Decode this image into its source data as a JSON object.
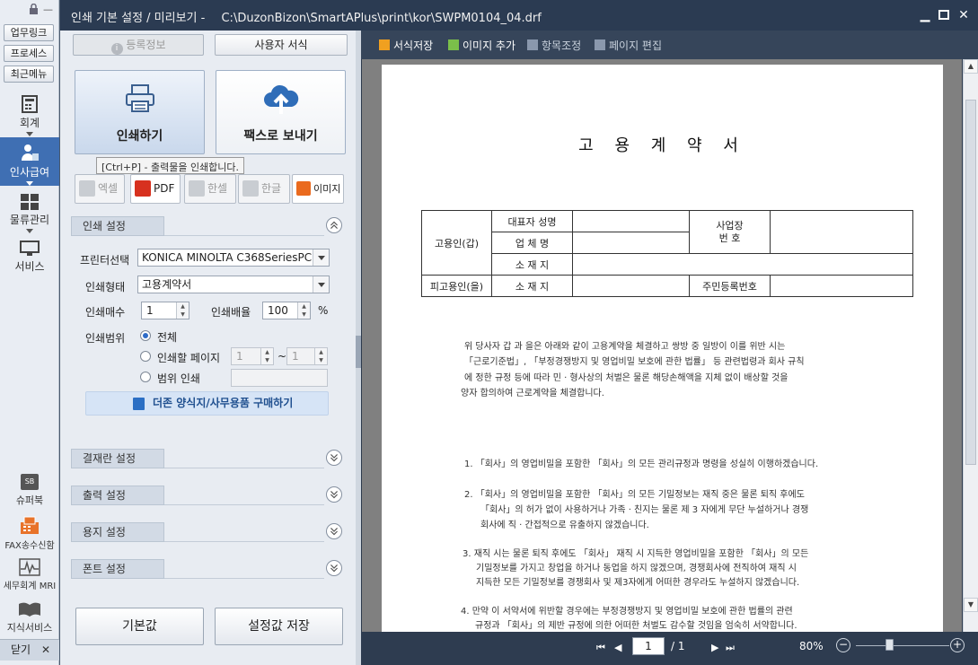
{
  "sidebar": {
    "quick_links": [
      "업무링크",
      "프로세스",
      "최근메뉴"
    ],
    "nav": [
      {
        "label": "회계",
        "icon": "calculator-icon"
      },
      {
        "label": "인사급여",
        "icon": "person-icon"
      },
      {
        "label": "물류관리",
        "icon": "grid-icon"
      },
      {
        "label": "서비스",
        "icon": "monitor-icon"
      }
    ],
    "bottom": [
      {
        "label": "슈퍼북",
        "badge": "SB"
      },
      {
        "label": "FAX송수신함"
      },
      {
        "label": "세무회계 MRI"
      },
      {
        "label": "지식서비스"
      }
    ],
    "close_label": "닫기"
  },
  "window": {
    "title": "인쇄 기본 설정 / 미리보기 -",
    "path": "C:\\DuzonBizon\\SmartAPlus\\print\\kor\\SWPM0104_04.drf"
  },
  "settings": {
    "register_label": "등록정보",
    "user_form_label": "사용자 서식",
    "print_label": "인쇄하기",
    "fax_label": "팩스로 보내기",
    "tooltip": "[Ctrl+P] - 출력물을 인쇄합니다.",
    "exports": [
      "엑셀",
      "PDF",
      "한셀",
      "한글",
      "이미지"
    ],
    "print_section": "인쇄 설정",
    "printer_label": "프린터선택",
    "printer_value": "KONICA MINOLTA C368SeriesPCL",
    "format_label": "인쇄형태",
    "format_value": "고용계약서",
    "copies_label": "인쇄매수",
    "copies_value": "1",
    "scale_label": "인쇄배율",
    "scale_value": "100",
    "scale_unit": "%",
    "range_label": "인쇄범위",
    "range_all": "전체",
    "range_pages": "인쇄할 페이지",
    "page_from": "1",
    "page_to": "1",
    "range_sep": "~",
    "range_scope": "범위 인쇄",
    "buy_banner": "더존 양식지/사무용품 구매하기",
    "collapsed_sections": [
      "결재란 설정",
      "출력 설정",
      "용지 설정",
      "폰트 설정"
    ],
    "default_label": "기본값",
    "save_label": "설정값 저장"
  },
  "preview": {
    "toolbar": [
      "서식저장",
      "이미지 추가",
      "항목조정",
      "페이지 편집"
    ],
    "doc_title": "고 용 계 약 서",
    "table": {
      "employer": "고용인(갑)",
      "rep": "대표자 성명",
      "company": "업 체 명",
      "addr": "소 재 지",
      "biz_no": "사업장\n번 호",
      "employee": "피고용인(을)",
      "addr2": "소 재 지",
      "rrn": "주민등록번호"
    },
    "intro": [
      "위 당사자 갑 과 을은 아래와 같이 고용계약을 체결하고 쌍방 중 일방이 이를 위반 시는",
      "「근로기준법」, 「부정경쟁방지 및 영업비밀 보호에 관한 법률」 등 관련법령과 회사 규칙",
      "에 정한 규정 등에 따라 민 · 형사상의 처벌은 물론 해당손해액을 지체 없이 배상할 것을",
      "양자 합의하여 근로계약을 체결합니다."
    ],
    "clauses": [
      [
        "1. 「회사」의 영업비밀을 포함한 「회사」의 모든 관리규정과 명령을 성실히 이행하겠습니다."
      ],
      [
        "2. 「회사」의 영업비밀을 포함한 「회사」의 모든 기밀정보는 재직 중은 물론 퇴직 후에도",
        "「회사」의 허가 없이 사용하거나 가족 · 친지는 물론 제 3 자에게 무단 누설하거나 경쟁",
        "회사에 직 · 간접적으로 유출하지 않겠습니다."
      ],
      [
        "3. 재직 시는 물론 퇴직 후에도 「회사」 재직 시 지득한 영업비밀을 포함한 「회사」의 모든",
        "기밀정보를 가지고 창업을 하거나 동업을 하지 않겠으며, 경쟁회사에 전직하여 재직 시",
        "지득한 모든 기밀정보를 경쟁회사 및 제3자에게 어떠한 경우라도 누설하지 않겠습니다."
      ],
      [
        "4. 만약 이 서약서에 위반할 경우에는 부정경쟁방지 및 영업비밀 보호에 관한 법률의 관련",
        "규정과 「회사」의 제반 규정에 의한 어떠한 처벌도 감수할 것임을 엄숙히 서약합니다."
      ]
    ],
    "page_current": "1",
    "page_total": "/ 1",
    "zoom": "80%"
  }
}
